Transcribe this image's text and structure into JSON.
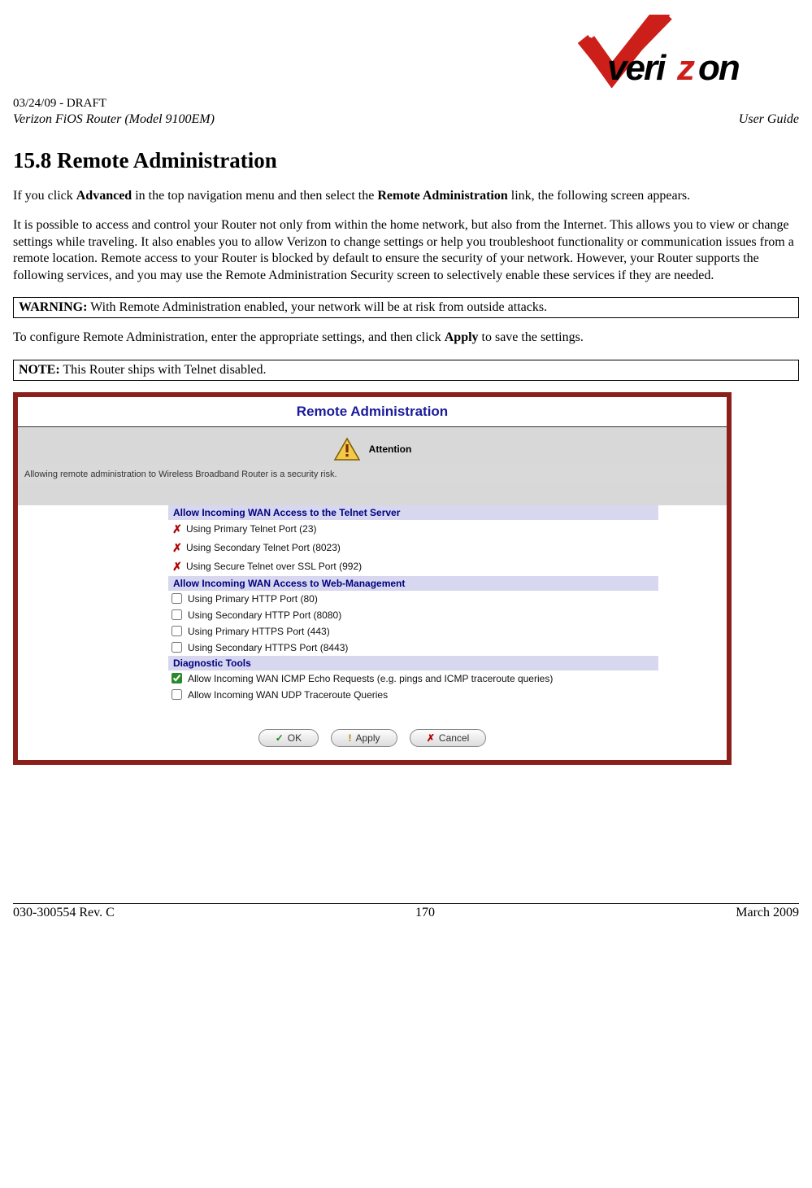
{
  "header": {
    "draft_line": "03/24/09 - DRAFT",
    "product_line": "Verizon FiOS Router (Model 9100EM)",
    "user_guide": "User Guide",
    "logo_text": "verizon"
  },
  "section": {
    "number_title": "15.8   Remote Administration",
    "para1_pre": "If you click ",
    "para1_b1": "Advanced",
    "para1_mid": " in the top navigation menu and then select the ",
    "para1_b2": "Remote Administration",
    "para1_post": " link, the following screen appears.",
    "para2": "It is possible to access and control your Router not only from within the home network, but also from the Internet. This allows you to view or change settings while traveling. It also enables you to allow Verizon to change settings or help you troubleshoot functionality or communication issues from a remote location. Remote access to your Router is blocked by default to ensure the security of your network. However, your Router supports the following services, and you may use the Remote Administration Security screen to selectively enable these services if they are needed.",
    "warning_b": "WARNING:",
    "warning_t": " With Remote Administration enabled, your network will be at risk from outside attacks.",
    "para3_pre": "To configure Remote Administration, enter the appropriate settings, and then click ",
    "para3_b": "Apply",
    "para3_post": " to save the settings.",
    "note_b": "NOTE:",
    "note_t": " This Router ships with Telnet disabled."
  },
  "screenshot": {
    "title": "Remote Administration",
    "attention_label": "Attention",
    "risk_text": "Allowing remote administration to Wireless Broadband Router is a security risk.",
    "groups": [
      {
        "header": "Allow Incoming WAN Access to the Telnet Server",
        "items": [
          {
            "kind": "x",
            "label": "Using Primary Telnet Port (23)"
          },
          {
            "kind": "x",
            "label": "Using Secondary Telnet Port (8023)"
          },
          {
            "kind": "x",
            "label": "Using Secure Telnet over SSL Port (992)"
          }
        ]
      },
      {
        "header": "Allow Incoming WAN Access to Web-Management",
        "items": [
          {
            "kind": "cb",
            "checked": false,
            "label": "Using Primary HTTP Port (80)"
          },
          {
            "kind": "cb",
            "checked": false,
            "label": "Using Secondary HTTP Port (8080)"
          },
          {
            "kind": "cb",
            "checked": false,
            "label": "Using Primary HTTPS Port (443)"
          },
          {
            "kind": "cb",
            "checked": false,
            "label": "Using Secondary HTTPS Port (8443)"
          }
        ]
      },
      {
        "header": "Diagnostic Tools",
        "items": [
          {
            "kind": "cb",
            "checked": true,
            "label": "Allow Incoming WAN ICMP Echo Requests (e.g. pings and ICMP traceroute queries)"
          },
          {
            "kind": "cb",
            "checked": false,
            "label": "Allow Incoming WAN UDP Traceroute Queries"
          }
        ]
      }
    ],
    "buttons": {
      "ok": "OK",
      "apply": "Apply",
      "cancel": "Cancel"
    }
  },
  "footer": {
    "left": "030-300554 Rev. C",
    "center": "170",
    "right": "March 2009"
  }
}
